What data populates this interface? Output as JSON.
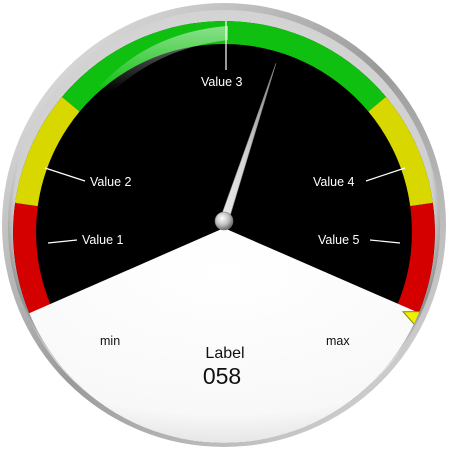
{
  "gauge": {
    "zone_labels": [
      "Value 1",
      "Value 2",
      "Value 3",
      "Value 4",
      "Value 5"
    ],
    "min_label": "min",
    "max_label": "max",
    "caption_label": "Label",
    "value_text": "058",
    "value": 58,
    "scale_min": 0,
    "scale_max": 100,
    "indicator_value": 100,
    "zones": [
      {
        "from": 0,
        "to": 14,
        "color": "#d40000"
      },
      {
        "from": 14,
        "to": 28,
        "color": "#d8d800"
      },
      {
        "from": 28,
        "to": 72,
        "color": "#10c010"
      },
      {
        "from": 72,
        "to": 86,
        "color": "#d8d800"
      },
      {
        "from": 86,
        "to": 100,
        "color": "#d40000"
      }
    ],
    "colors": {
      "dial_face": "#000000",
      "lower_panel": "#ffffff",
      "bezel": "#c8c8c8",
      "needle": "#bdbdbd",
      "indicator": "#f0f000"
    }
  }
}
